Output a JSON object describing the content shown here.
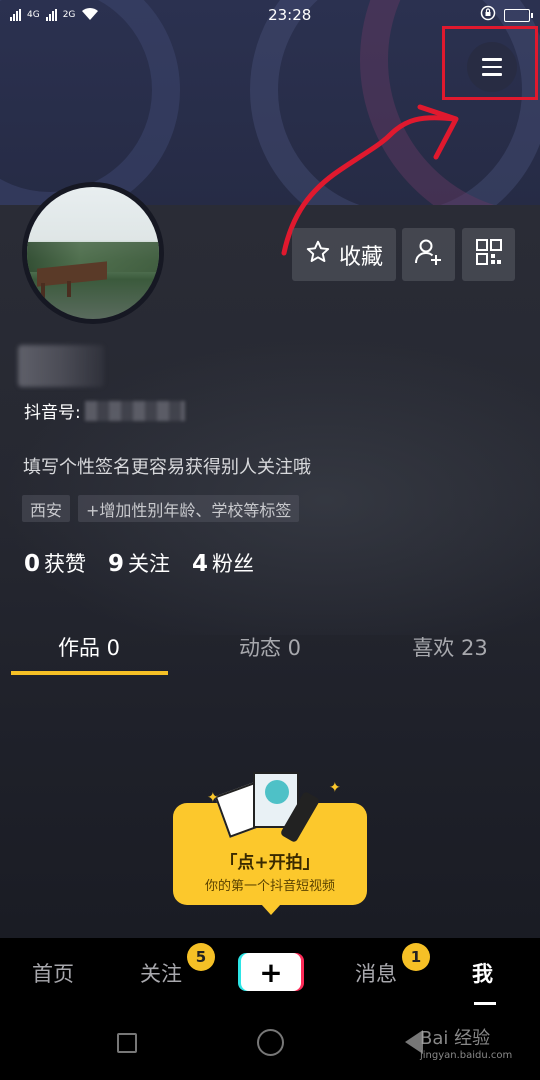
{
  "status_bar": {
    "network_labels": [
      "4G",
      "2G"
    ],
    "time": "23:28"
  },
  "header": {
    "menu_icon": "hamburger-menu-icon"
  },
  "profile": {
    "favorite_label": "收藏",
    "douyin_id_label": "抖音号:",
    "bio": "填写个性签名更容易获得别人关注哦",
    "tags": [
      "西安",
      "+增加性别年龄、学校等标签"
    ],
    "stats": [
      {
        "value": "0",
        "label": "获赞"
      },
      {
        "value": "9",
        "label": "关注"
      },
      {
        "value": "4",
        "label": "粉丝"
      }
    ]
  },
  "tabs": [
    {
      "label": "作品 0",
      "active": true
    },
    {
      "label": "动态 0",
      "active": false
    },
    {
      "label": "喜欢 23",
      "active": false
    }
  ],
  "empty_state": {
    "title": "「点+开拍」",
    "subtitle": "你的第一个抖音短视频"
  },
  "bottom_nav": {
    "home": "首页",
    "follow": "关注",
    "follow_badge": "5",
    "create": "+",
    "messages": "消息",
    "messages_badge": "1",
    "me": "我"
  },
  "watermark": {
    "brand": "Bai 经验",
    "url": "jingyan.baidu.com"
  },
  "colors": {
    "accent": "#f5c026",
    "annotation_red": "#e0192e",
    "background": "#161823"
  }
}
